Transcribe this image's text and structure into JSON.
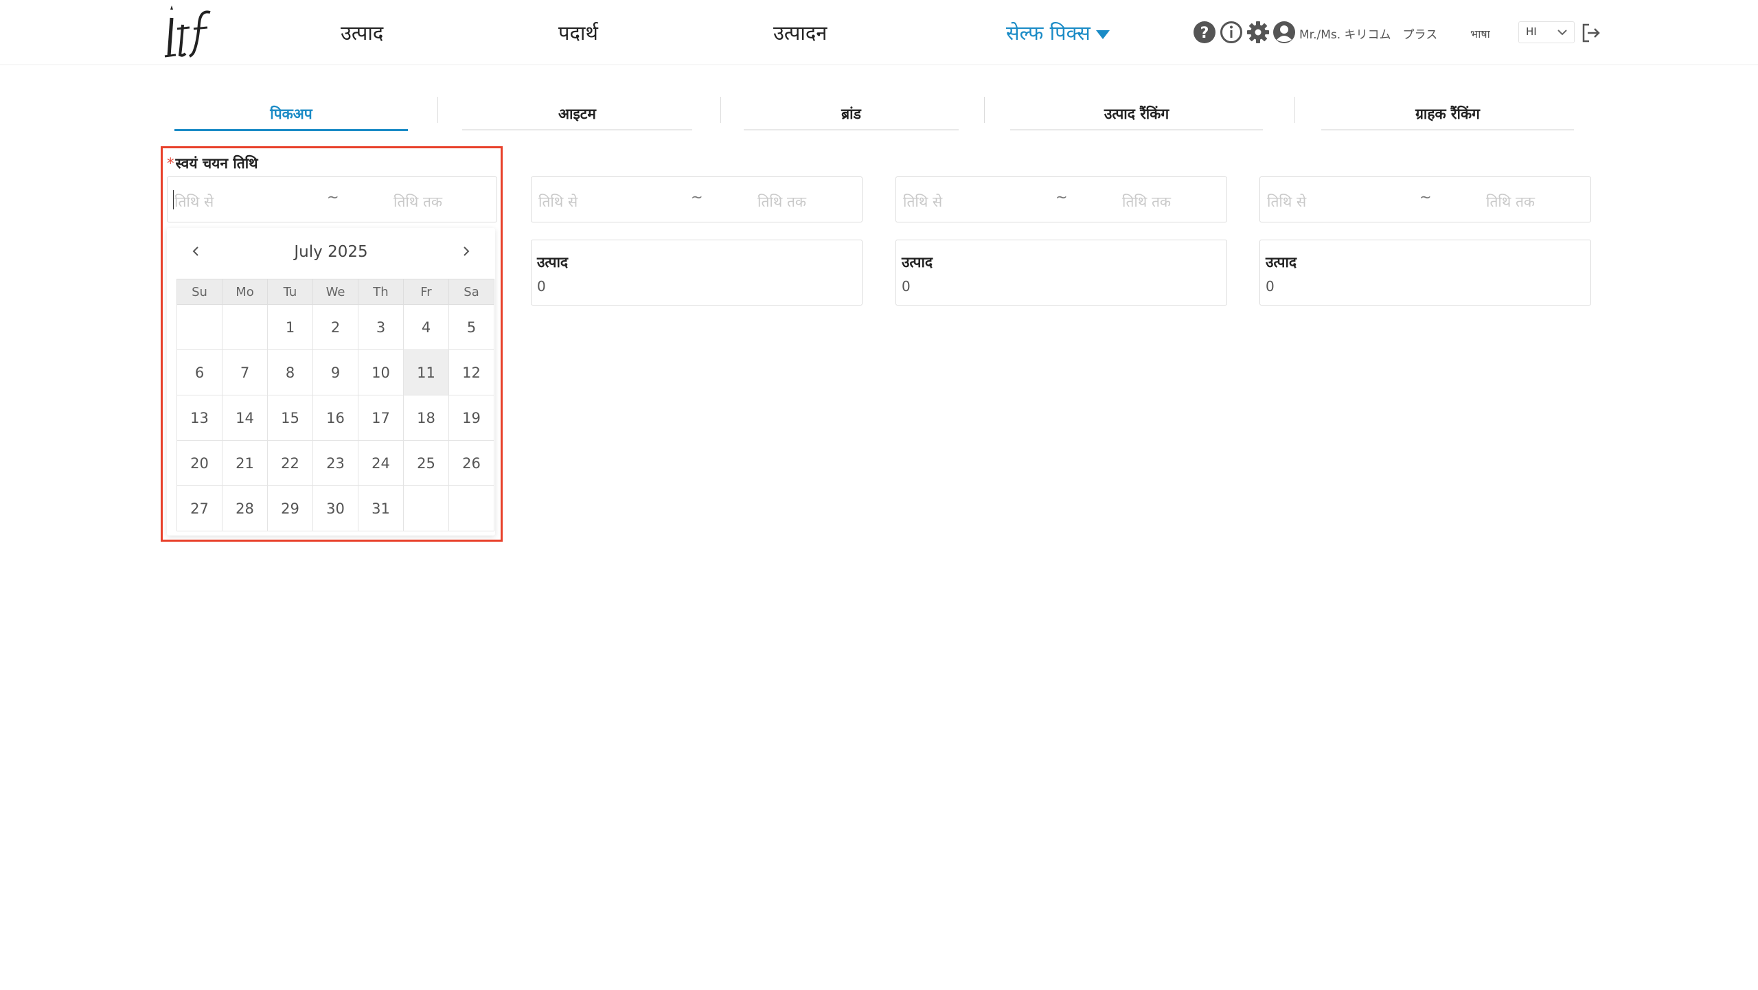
{
  "header": {
    "nav": [
      "उत्पाद",
      "पदार्थ",
      "उत्पादन"
    ],
    "nav_active": "सेल्फ पिक्स",
    "user_name": "Mr./Ms. キリコム　プラス",
    "lang_label": "भाषा",
    "lang_value": "HI",
    "icons": [
      "help-icon",
      "info-icon",
      "gear-icon",
      "user-icon",
      "logout-icon"
    ],
    "accent_color": "#1a8bc6"
  },
  "tabs": [
    "पिकअप",
    "आइटम",
    "ब्रांड",
    "उत्पाद रैंकिंग",
    "ग्राहक रैंकिंग"
  ],
  "active_tab": "पिकअप",
  "filter": {
    "label": "स्वयं चयन तिथि",
    "required_mark": "*",
    "from_placeholder": "तिथि से",
    "separator": "~",
    "to_placeholder": "तिथि तक"
  },
  "stats": [
    {
      "title": "उत्पाद",
      "value": "0"
    },
    {
      "title": "उत्पाद",
      "value": "0"
    },
    {
      "title": "उत्पाद",
      "value": "0"
    }
  ],
  "calendar": {
    "title": "July 2025",
    "weekdays": [
      "Su",
      "Mo",
      "Tu",
      "We",
      "Th",
      "Fr",
      "Sa"
    ],
    "weeks": [
      [
        "",
        "",
        "1",
        "2",
        "3",
        "4",
        "5"
      ],
      [
        "6",
        "7",
        "8",
        "9",
        "10",
        "11",
        "12"
      ],
      [
        "13",
        "14",
        "15",
        "16",
        "17",
        "18",
        "19"
      ],
      [
        "20",
        "21",
        "22",
        "23",
        "24",
        "25",
        "26"
      ],
      [
        "27",
        "28",
        "29",
        "30",
        "31",
        "",
        ""
      ]
    ],
    "highlighted_day": "11"
  }
}
